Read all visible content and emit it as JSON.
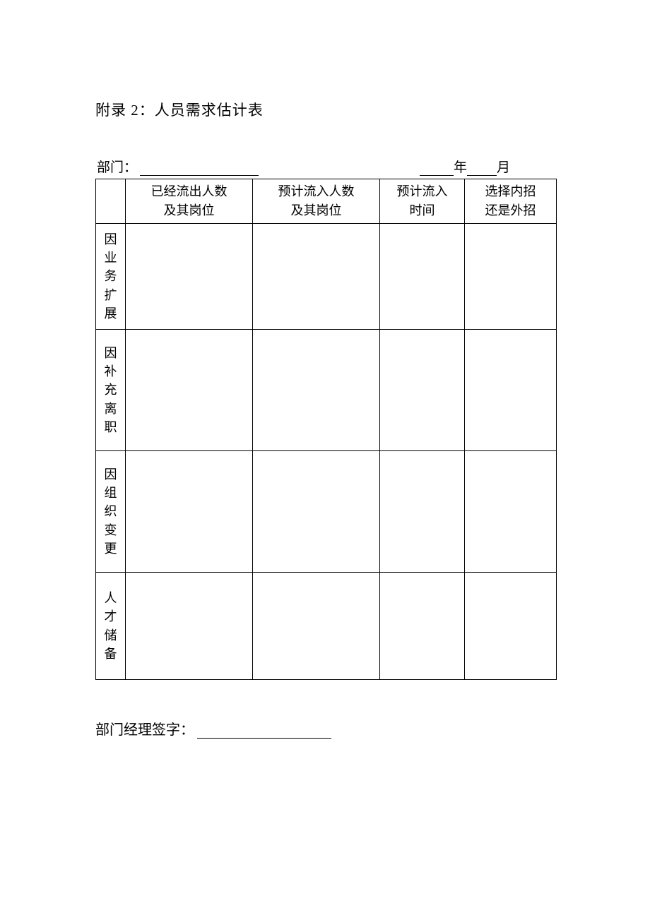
{
  "title": "附录 2：人员需求估计表",
  "header": {
    "dept_label": "部门：",
    "year_label": "年",
    "month_label": "月"
  },
  "table": {
    "columns": {
      "c1_line1": "已经流出人数",
      "c1_line2": "及其岗位",
      "c2_line1": "预计流入人数",
      "c2_line2": "及其岗位",
      "c3_line1": "预计流入",
      "c3_line2": "时间",
      "c4_line1": "选择内招",
      "c4_line2": "还是外招"
    },
    "rows": {
      "r1": "因业务扩展",
      "r2": "因补充离职",
      "r3": "因组织变更",
      "r4": "人才储备"
    }
  },
  "signature_label": "部门经理签字："
}
